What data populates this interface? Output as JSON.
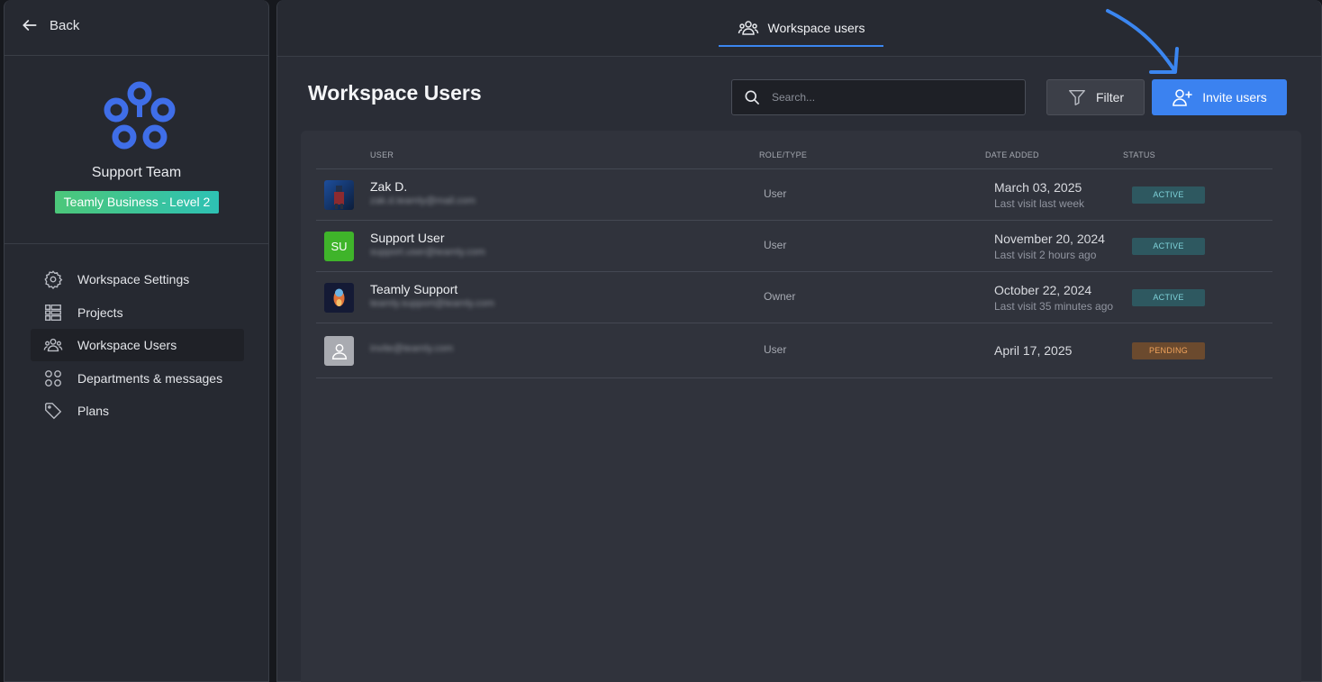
{
  "sidebar": {
    "back_label": "Back",
    "team_name": "Support Team",
    "plan_badge": "Teamly Business - Level 2",
    "items": [
      {
        "label": "Workspace Settings",
        "icon": "gear-icon",
        "active": false
      },
      {
        "label": "Projects",
        "icon": "list-icon",
        "active": false
      },
      {
        "label": "Workspace Users",
        "icon": "users-icon",
        "active": true
      },
      {
        "label": "Departments & messages",
        "icon": "grid-icon",
        "active": false
      },
      {
        "label": "Plans",
        "icon": "tag-icon",
        "active": false
      }
    ]
  },
  "header": {
    "tab_label": "Workspace users"
  },
  "main": {
    "title": "Workspace Users",
    "search_placeholder": "Search...",
    "filter_label": "Filter",
    "invite_label": "Invite users",
    "columns": {
      "user": "USER",
      "role": "ROLE/TYPE",
      "date": "DATE ADDED",
      "status": "STATUS"
    },
    "rows": [
      {
        "name": "Zak D.",
        "email": "zak.d.teamly@mail.com",
        "role": "User",
        "date": "March 03, 2025",
        "last_visit": "Last visit last week",
        "status": "ACTIVE",
        "avatar": "photo-avatar"
      },
      {
        "name": "Support User",
        "email": "support.user@teamly.com",
        "role": "User",
        "date": "November 20, 2024",
        "last_visit": "Last visit 2 hours ago",
        "status": "ACTIVE",
        "avatar_initials": "SU"
      },
      {
        "name": "Teamly Support",
        "email": "teamly.support@teamly.com",
        "role": "Owner",
        "date": "October 22, 2024",
        "last_visit": "Last visit 35 minutes ago",
        "status": "ACTIVE",
        "avatar": "mascot-avatar"
      },
      {
        "name": "",
        "email": "invite@teamly.com",
        "role": "User",
        "date": "April 17, 2025",
        "last_visit": "",
        "status": "PENDING",
        "avatar": "placeholder-avatar"
      }
    ]
  },
  "colors": {
    "accent": "#3b82f0",
    "active_badge": "#2e5860",
    "pending_badge": "#6b4a2e",
    "su_avatar": "#3fb42a"
  }
}
